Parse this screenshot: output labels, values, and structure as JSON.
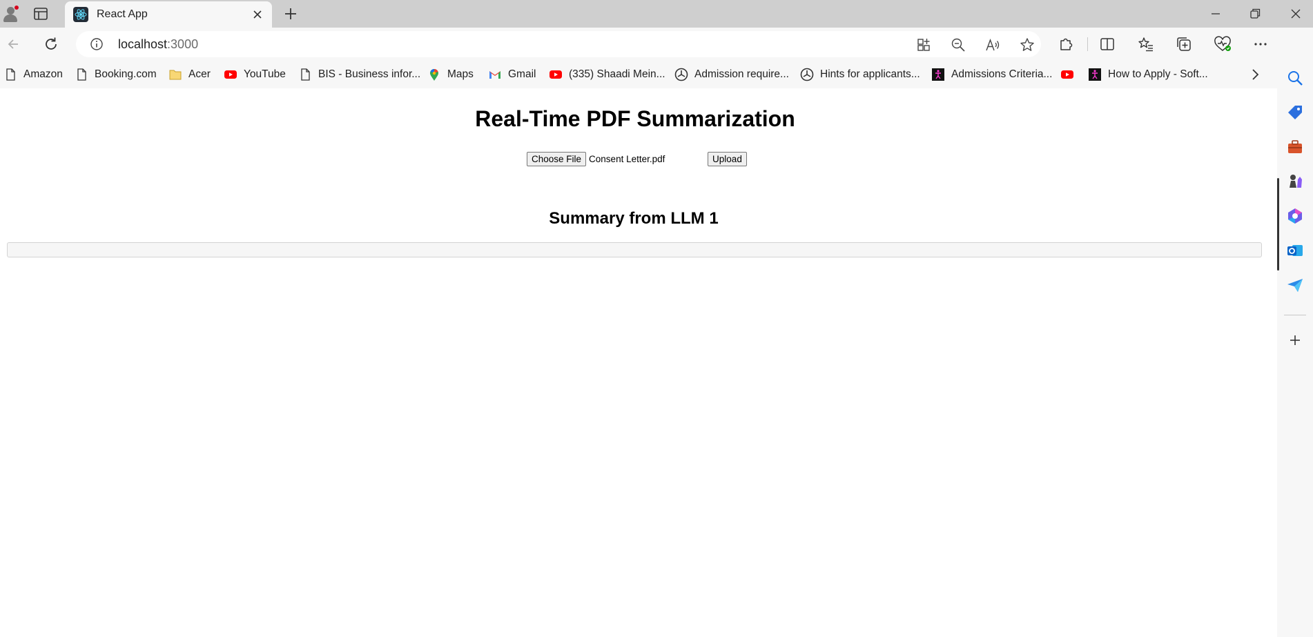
{
  "browser": {
    "tab": {
      "title": "React App"
    },
    "address": {
      "host": "localhost",
      "port": ":3000"
    },
    "favorites": [
      {
        "label": "Amazon",
        "icon": "page-icon"
      },
      {
        "label": "Booking.com",
        "icon": "page-icon"
      },
      {
        "label": "Acer",
        "icon": "folder-icon"
      },
      {
        "label": "YouTube",
        "icon": "youtube-icon"
      },
      {
        "label": "BIS - Business infor...",
        "icon": "page-icon"
      },
      {
        "label": "Maps",
        "icon": "maps-pin-icon"
      },
      {
        "label": "Gmail",
        "icon": "gmail-icon"
      },
      {
        "label": "(335) Shaadi Mein...",
        "icon": "youtube-icon"
      },
      {
        "label": "Admission require...",
        "icon": "university-icon"
      },
      {
        "label": "Hints for applicants...",
        "icon": "university-icon"
      },
      {
        "label": "Admissions Criteria...",
        "icon": "accessibility-icon"
      },
      {
        "label": "",
        "icon": "youtube-icon"
      },
      {
        "label": "How to Apply - Soft...",
        "icon": "accessibility-icon"
      }
    ],
    "colors": {
      "youtube": "#ff0000",
      "accent": "#0067c0",
      "tabstrip": "#cfcfcf",
      "toolbar": "#f7f7f7"
    }
  },
  "app": {
    "heading": "Real-Time PDF Summarization",
    "choose_file_label": "Choose File",
    "file_name": "Consent Letter.pdf",
    "upload_label": "Upload",
    "summary_heading": "Summary from LLM 1",
    "summary_text": ""
  }
}
